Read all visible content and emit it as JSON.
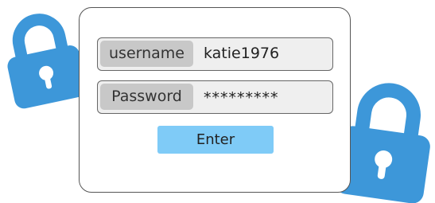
{
  "colors": {
    "lock_blue": "#3d97d9",
    "field_background": "#efefef",
    "label_background": "#c8c8c8",
    "button_background": "#7fcbf7"
  },
  "login_form": {
    "username_label": "username",
    "username_value": "katie1976",
    "password_label": "Password",
    "password_value": "*********",
    "enter_label": "Enter"
  },
  "decorations": {
    "left_icon": "padlock-icon",
    "right_icon": "padlock-icon"
  }
}
